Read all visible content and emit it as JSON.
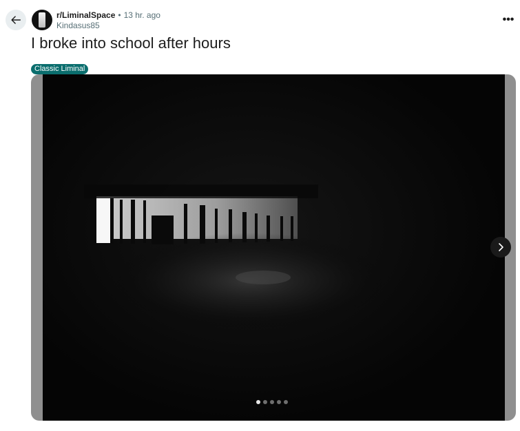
{
  "post": {
    "subreddit": "r/LiminalSpace",
    "separator": "•",
    "time_ago": "13 hr. ago",
    "author": "Kindasus85",
    "title": "I broke into school after hours",
    "flair": "Classic Liminal"
  },
  "gallery": {
    "image_count": 5,
    "current_index": 1
  },
  "icons": {
    "back": "arrow-left-icon",
    "more": "more-horizontal-icon",
    "next": "chevron-right-icon"
  },
  "colors": {
    "flair_bg": "#0b6e6e",
    "back_btn_bg": "#e9eef0"
  },
  "more_glyph": "•••"
}
